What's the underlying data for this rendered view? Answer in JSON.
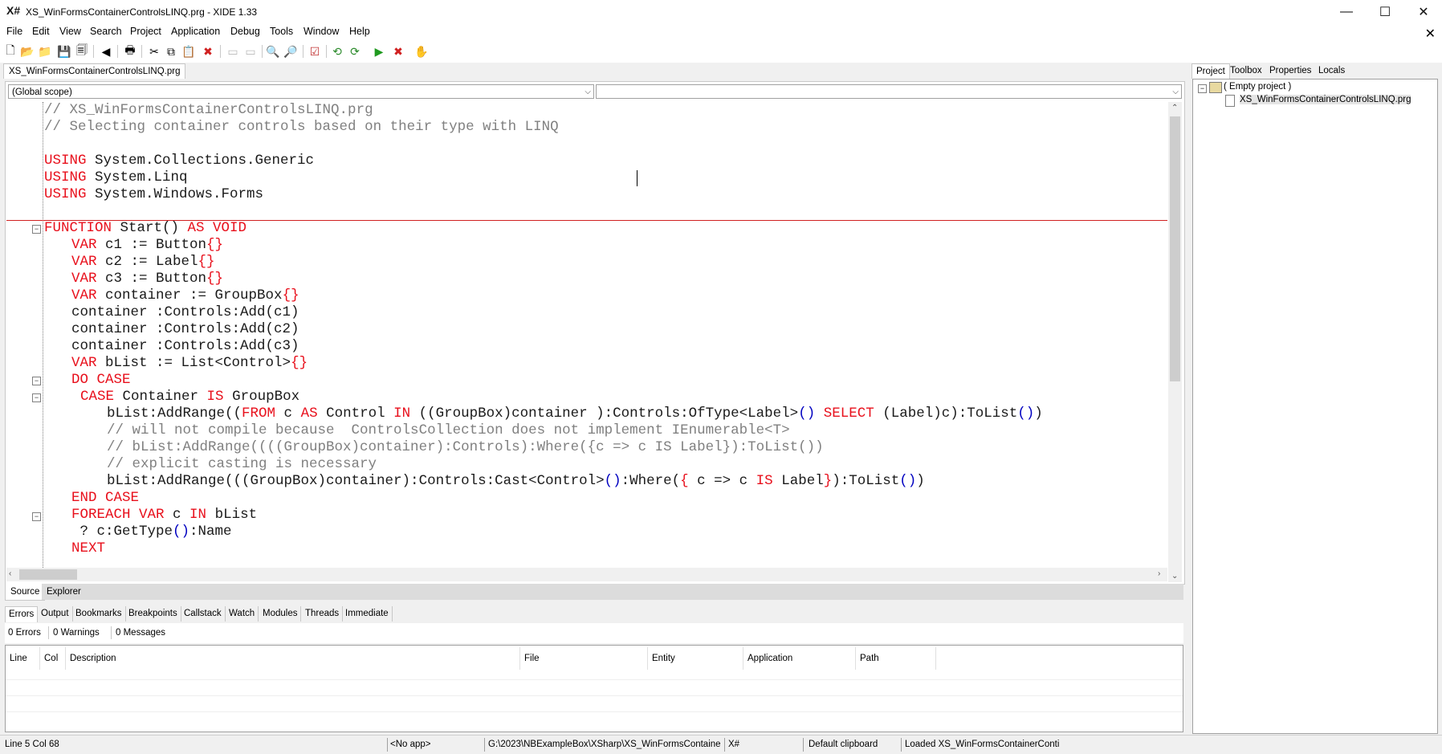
{
  "window": {
    "title": "XS_WinFormsContainerControlsLINQ.prg - XIDE 1.33",
    "logo": "X#",
    "min_glyph": "—",
    "max_glyph": "☐",
    "close_glyph": "✕"
  },
  "menu": {
    "items": [
      "File",
      "Edit",
      "View",
      "Search",
      "Project",
      "Application",
      "Debug",
      "Tools",
      "Window",
      "Help"
    ],
    "close_glyph": "✕"
  },
  "toolbar": {
    "icons": [
      "new-file-icon",
      "open-file-icon",
      "open-folder-icon",
      "save-icon",
      "save-all-icon",
      "back-icon",
      "print-icon",
      "cut-icon",
      "copy-icon",
      "paste-icon",
      "delete-icon",
      "disabled-icon-1",
      "disabled-icon-2",
      "find-icon",
      "find-in-files-icon",
      "checklist-icon",
      "build-icon",
      "rebuild-icon",
      "run-icon",
      "stop-icon",
      "hand-icon"
    ],
    "glyphs": [
      "🗋",
      "📂",
      "📁",
      "💾",
      "🗐",
      "◀",
      "🖶",
      "✂",
      "⧉",
      "📋",
      "✖",
      "▭",
      "▭",
      "🔍",
      "🔎",
      "☑",
      "⟲",
      "⟳",
      "▶",
      "✖",
      "✋"
    ]
  },
  "document_tab": "XS_WinFormsContainerControlsLINQ.prg",
  "scope_combo": {
    "left_value": "(Global scope)",
    "right_value": "",
    "arrow": "⌵"
  },
  "code": {
    "line1": "// XS_WinFormsContainerControlsLINQ.prg",
    "line2": "// Selecting container controls based on their type with LINQ",
    "using": "USING",
    "ns1": " System.Collections.Generic",
    "ns2": " System.Linq",
    "ns3": " System.Windows.Forms",
    "function_kw": "FUNCTION",
    "start_sig": " Start() ",
    "as_kw": "AS",
    "void_kw": " VOID",
    "var_kw": "VAR",
    "c1_decl": " c1 := Button",
    "c2_decl": " c2 := Label",
    "c3_decl": " c3 := Button",
    "container_decl": " container := GroupBox",
    "braces": "{}",
    "add1": "container :Controls:Add(c1)",
    "add2": "container :Controls:Add(c2)",
    "add3": "container :Controls:Add(c3)",
    "blist_decl": " bList := List<Control>",
    "do_case": "DO CASE",
    "case_kw": "CASE",
    "case_cond": " Container ",
    "is_kw": "IS",
    "groupbox": " GroupBox",
    "addrange_pre": "bList:AddRange((",
    "from_kw": "FROM",
    "c_sp": " c ",
    "as2": "AS",
    "control_sp": " Control ",
    "in_kw": "IN",
    "linq_mid": " ((GroupBox)container ):Controls:OfType<Label>",
    "paren_open_close": "()",
    "sp": " ",
    "select_kw": "SELECT",
    "linq_tail": " (Label)c):ToList",
    "comment1": "// will not compile because  ControlsCollection does not implement IEnumerable<T>",
    "comment2": "// bList:AddRange((((GroupBox)container):Controls):Where({c => c IS Label}):ToList())",
    "comment3": "// explicit casting is necessary",
    "cast_pre": "bList:AddRange(((GroupBox)container):Controls:Cast<Control>",
    "where_open": ":Where(",
    "lbrace": "{",
    "lambda": " c => c ",
    "is2": "IS",
    "label_sp": " Label",
    "rbrace": "}",
    "where_close": "):ToList",
    "end_case": "END CASE",
    "foreach_kw": "FOREACH",
    "var2": " VAR",
    "c_in": " c ",
    "in2": "IN",
    "blist": " bList",
    "print_line": " ? c:GetType",
    "name_tail": ":Name",
    "next_kw": "NEXT",
    "fold_glyph": "−"
  },
  "editor_tabs": [
    "Source",
    "Explorer"
  ],
  "bottom_tabs": [
    "Errors",
    "Output",
    "Bookmarks",
    "Breakpoints",
    "Callstack",
    "Watch",
    "Modules",
    "Threads",
    "Immediate"
  ],
  "counts": {
    "errors": "0 Errors",
    "warnings": "0 Warnings",
    "messages": "0 Messages"
  },
  "error_columns": [
    "Line",
    "Col",
    "Description",
    "File",
    "Entity",
    "Application",
    "Path"
  ],
  "right_tabs": [
    "Project",
    "Toolbox",
    "Properties",
    "Locals"
  ],
  "project_tree": {
    "root": "( Empty project )",
    "file": "XS_WinFormsContainerControlsLINQ.prg",
    "expander": "−"
  },
  "statusbar": {
    "position": "Line 5  Col 68",
    "app": "<No app>",
    "path": "G:\\2023\\NBExampleBox\\XSharp\\XS_WinFormsContaine",
    "lang": "X#",
    "clipboard": "Default clipboard",
    "loaded": "Loaded XS_WinFormsContainerConti"
  },
  "colors": {
    "keyword": "#e8101c",
    "comment": "#808080",
    "brace": "#0000c0"
  }
}
